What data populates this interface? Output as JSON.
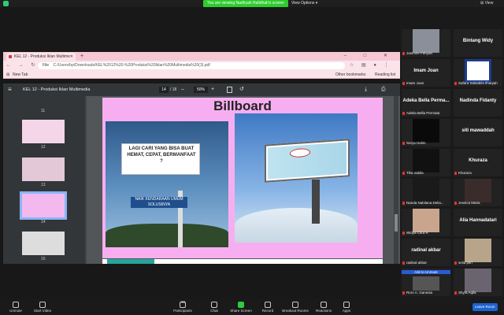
{
  "topbar": {
    "banner": "You are viewing Nadhyah Hafidhah's screen",
    "view_options": "View Options ▾",
    "view": "⊞ View"
  },
  "browser": {
    "tab_title": "KEL 12 - Produksi Iklan Multime",
    "new_tab": "+",
    "window_controls": "– □ ✕",
    "nav": "← → ↻",
    "scheme": "File",
    "url": "C:/Users/hp/Downloads/KEL%2012%20-%20Produksi%20Iklan%20Multimedia%20(3).pdf",
    "addr_icons": "☆ ▤ ● ⋮",
    "bookmarks": {
      "apps": "⊞",
      "new_tab": "New Tab",
      "other": "Other bookmarks",
      "reading": "Reading list"
    }
  },
  "pdf": {
    "menu": "≡",
    "title": "KEL 12 - Produksi Iklan Multimedia",
    "page": "14",
    "total": "/ 18",
    "zoom_minus": "–",
    "zoom": "50%",
    "zoom_plus": "+",
    "rotate": "↺",
    "right_icons": "⤓ ⎙ ⋮",
    "thumbs": [
      {
        "label": "11"
      },
      {
        "label": "12"
      },
      {
        "label": "13"
      },
      {
        "label": "14"
      },
      {
        "label": "15"
      }
    ],
    "slide": {
      "heading": "Billboard",
      "sign_question": "LAGI CARI YANG BISA BUAT HEMAT, CEPAT, BERMANFAAT ?",
      "sign_button": "NAIK KENDARAAN UMUM SOLUSINYA"
    }
  },
  "gallery": [
    {
      "name": "Jasmine Febyan",
      "big": ""
    },
    {
      "name": "",
      "big": "Bintang Widy"
    },
    {
      "name": "Imam Joan",
      "big": "Imam Joan"
    },
    {
      "name": "Safara Salsabila Ilhaqiah",
      "big": ""
    },
    {
      "name": "Adeka Bella Permata",
      "big": "Adeka Bella Perma..."
    },
    {
      "name": "Nadinda Fidanty",
      "big": "Nadinda Fidanty"
    },
    {
      "name": "Surya Halim",
      "big": ""
    },
    {
      "name": "siti mawaddah",
      "big": "siti mawaddah"
    },
    {
      "name": "Tika nabila",
      "big": ""
    },
    {
      "name": "Khuraza",
      "big": "Khuraza"
    },
    {
      "name": "Nanda Nabilana Delia...",
      "big": ""
    },
    {
      "name": "Jessica Maria",
      "big": ""
    },
    {
      "name": "Widya Citra R",
      "big": ""
    },
    {
      "name": "Alia Hannadatari",
      "big": "Alia Hannadatari"
    },
    {
      "name": "radinal akbar",
      "big": "radinal akbar"
    },
    {
      "name": "selia pitri",
      "big": ""
    },
    {
      "name": "Roro A. Ganesia",
      "big": "Ask to Unmute"
    },
    {
      "name": "Shyfa Aqila",
      "big": ""
    }
  ],
  "toolbar": {
    "unmute": "Unmute",
    "start_video": "Start Video",
    "participants": "Participants",
    "participants_count": "36",
    "chat": "Chat",
    "share_screen": "Share Screen",
    "record": "Record",
    "breakout": "Breakout Rooms",
    "reactions": "Reactions",
    "apps": "Apps",
    "leave": "Leave Room"
  }
}
